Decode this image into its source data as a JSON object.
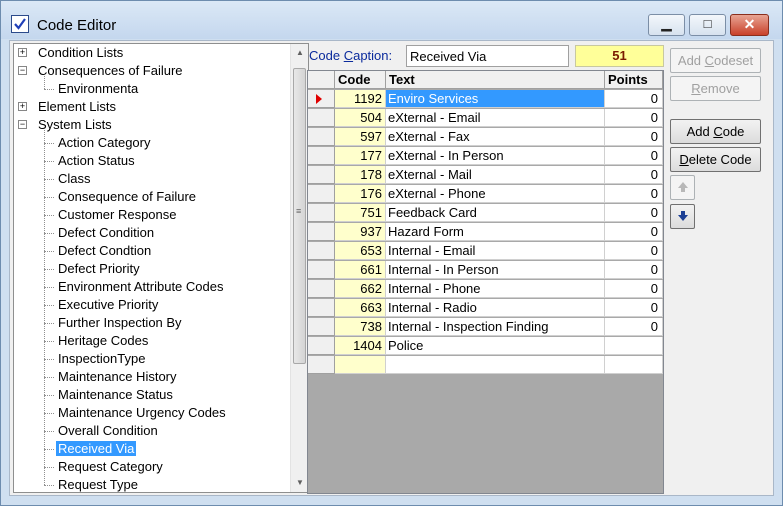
{
  "window": {
    "title": "Code Editor",
    "minimize_glyph": "▁",
    "maximize_glyph": "□",
    "close_glyph": "✕"
  },
  "tree": {
    "nodes": [
      {
        "label": "Condition Lists",
        "expander": "+"
      },
      {
        "label": "Consequences of Failure",
        "expander": "−"
      },
      {
        "label": "Environmenta"
      },
      {
        "label": "Element Lists",
        "expander": "+"
      },
      {
        "label": "System Lists",
        "expander": "−"
      },
      {
        "label": "Action Category"
      },
      {
        "label": "Action Status"
      },
      {
        "label": "Class"
      },
      {
        "label": "Consequence of Failure"
      },
      {
        "label": "Customer Response"
      },
      {
        "label": "Defect Condition"
      },
      {
        "label": "Defect Condtion"
      },
      {
        "label": "Defect Priority"
      },
      {
        "label": "Environment Attribute Codes"
      },
      {
        "label": "Executive Priority"
      },
      {
        "label": "Further Inspection By"
      },
      {
        "label": "Heritage Codes"
      },
      {
        "label": "InspectionType"
      },
      {
        "label": "Maintenance History"
      },
      {
        "label": "Maintenance Status"
      },
      {
        "label": "Maintenance Urgency Codes"
      },
      {
        "label": "Overall Condition"
      },
      {
        "label": "Received Via",
        "selected": true
      },
      {
        "label": "Request Category"
      },
      {
        "label": "Request Type"
      }
    ],
    "scroll_up": "▲",
    "scroll_down": "▼",
    "grip": "≡"
  },
  "caption": {
    "label_prefix": "Code ",
    "label_underlined": "C",
    "label_rest": "aption:",
    "value": "Received Via",
    "count": "51"
  },
  "grid": {
    "headers": {
      "code": "Code",
      "text": "Text",
      "points": "Points"
    },
    "rows": [
      {
        "code": "1192",
        "text": "Enviro Services",
        "points": "0",
        "current": true
      },
      {
        "code": "504",
        "text": "eXternal - Email",
        "points": "0"
      },
      {
        "code": "597",
        "text": "eXternal - Fax",
        "points": "0"
      },
      {
        "code": "177",
        "text": "eXternal - In Person",
        "points": "0"
      },
      {
        "code": "178",
        "text": "eXternal - Mail",
        "points": "0"
      },
      {
        "code": "176",
        "text": "eXternal - Phone",
        "points": "0"
      },
      {
        "code": "751",
        "text": "Feedback Card",
        "points": "0"
      },
      {
        "code": "937",
        "text": "Hazard Form",
        "points": "0"
      },
      {
        "code": "653",
        "text": "Internal - Email",
        "points": "0"
      },
      {
        "code": "661",
        "text": "Internal - In Person",
        "points": "0"
      },
      {
        "code": "662",
        "text": "Internal - Phone",
        "points": "0"
      },
      {
        "code": "663",
        "text": "Internal - Radio",
        "points": "0"
      },
      {
        "code": "738",
        "text": "Internal - Inspection Finding",
        "points": "0"
      },
      {
        "code": "1404",
        "text": "Police",
        "points": ""
      },
      {
        "code": "",
        "text": "",
        "points": ""
      }
    ]
  },
  "buttons": {
    "add_codeset": {
      "pre": "Add ",
      "ul": "C",
      "post": "odeset",
      "enabled": false
    },
    "remove": {
      "pre": "",
      "ul": "R",
      "post": "emove",
      "enabled": false
    },
    "add_code": {
      "pre": "Add ",
      "ul": "C",
      "post": "ode",
      "enabled": true
    },
    "delete_code": {
      "pre": "",
      "ul": "D",
      "post": "elete Code",
      "enabled": true
    }
  },
  "colors": {
    "selection": "#3399ff",
    "code_column": "#ffffcc",
    "count_box": "#ffff99",
    "row_marker": "#e00000",
    "move_down_arrow": "#1c3f94"
  }
}
